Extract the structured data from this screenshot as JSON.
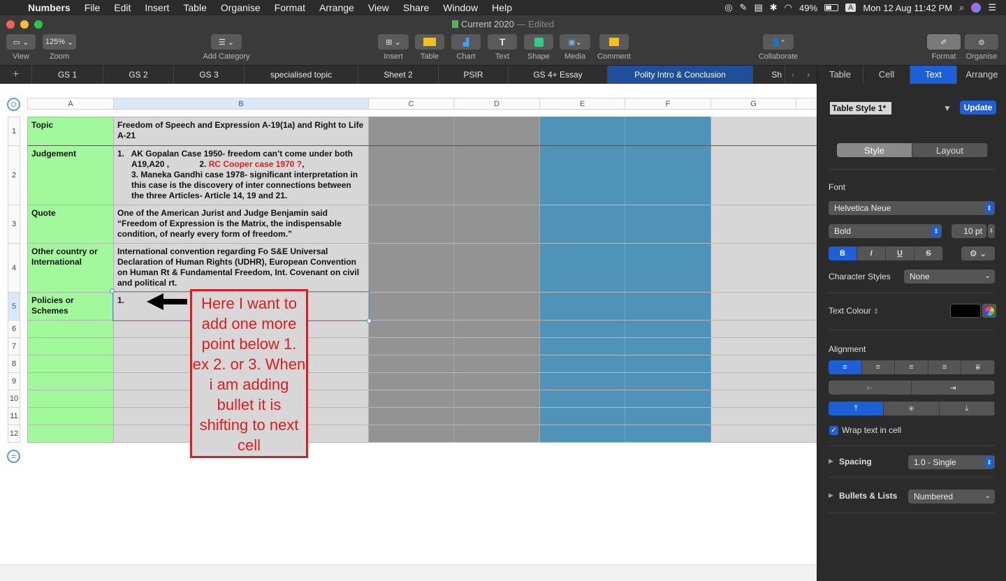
{
  "menubar": {
    "apple": "",
    "items": [
      "Numbers",
      "File",
      "Edit",
      "Insert",
      "Table",
      "Organise",
      "Format",
      "Arrange",
      "View",
      "Share",
      "Window",
      "Help"
    ],
    "battery": "49%",
    "input": "A",
    "clock": "Mon 12 Aug  11:42 PM"
  },
  "window": {
    "title": "Current 2020",
    "edited": "— Edited"
  },
  "toolbar": {
    "view": "View",
    "zoom_value": "125%",
    "zoom": "Zoom",
    "add_category": "Add Category",
    "insert": "Insert",
    "table": "Table",
    "chart": "Chart",
    "text": "Text",
    "shape": "Shape",
    "media": "Media",
    "comment": "Comment",
    "collaborate": "Collaborate",
    "format": "Format",
    "organise": "Organise"
  },
  "sheets": {
    "add": "+",
    "tabs": [
      "GS 1",
      "GS 2",
      "GS 3",
      "specialised topic",
      "Sheet 2",
      "PSIR",
      "GS 4+ Essay",
      "Polity Intro & Conclusion",
      "Sh"
    ],
    "active": "Polity Intro & Conclusion"
  },
  "grid": {
    "columns": [
      "A",
      "B",
      "C",
      "D",
      "E",
      "F",
      "G"
    ],
    "rows": [
      "1",
      "2",
      "3",
      "4",
      "5",
      "6",
      "7",
      "8",
      "9",
      "10",
      "11",
      "12"
    ],
    "cells": {
      "a1": "Topic",
      "b1": "Freedom of Speech and Expression A-19(1a) and Right to Life A-21",
      "a2": "Judgement",
      "b2_l1": "1.   AK Gopalan Case 1950- freedom can’t come under both",
      "b2_l2a": "A19,A20 ,             2. ",
      "b2_l2b": "RC Cooper case 1970 ?",
      "b2_l2c": ",",
      "b2_l3": "3. Maneka Gandhi case 1978- significant interpretation in this case is the discovery of inter connections between the three Articles- Article 14, 19 and 21.",
      "a3": "Quote",
      "b3": "One of the American Jurist and Judge Benjamin said “Freedom of Expression is the Matrix, the indispensable condition, of nearly every form of freedom.”",
      "a4": "Other country or International",
      "b4": "International convention regarding Fo S&E Universal Declaration of Human Rights (UDHR), European Convention on Human Rt & Fundamental Freedom, Int. Covenant on civil and political rt.",
      "a5": "Policies or Schemes",
      "b5": "1."
    }
  },
  "annotation": "Here I want to add one more point below 1. ex 2. or 3. When i am adding bullet it is shifting to next cell",
  "sidebar": {
    "tabs": [
      "Table",
      "Cell",
      "Text",
      "Arrange"
    ],
    "active_tab": "Text",
    "style_name": "Table Style 1*",
    "update": "Update",
    "style": "Style",
    "layout": "Layout",
    "font_label": "Font",
    "font_family": "Helvetica Neue",
    "font_weight": "Bold",
    "font_size": "10 pt",
    "bold": "B",
    "italic": "I",
    "underline": "U",
    "strike": "S",
    "character_styles_label": "Character Styles",
    "character_styles": "None",
    "text_colour_label": "Text Colour",
    "text_colour": "#000000",
    "alignment_label": "Alignment",
    "wrap": "Wrap text in cell",
    "spacing_label": "Spacing",
    "spacing": "1.0 - Single",
    "bullets_label": "Bullets & Lists",
    "bullets": "Numbered"
  },
  "colors": {
    "accent": "#1c5fd6",
    "col_a": "#a2f99c",
    "col_b": "#d7d7d7",
    "col_cd": "#939393",
    "col_ef": "#4f93b9",
    "annotation": "#e11b1b"
  }
}
